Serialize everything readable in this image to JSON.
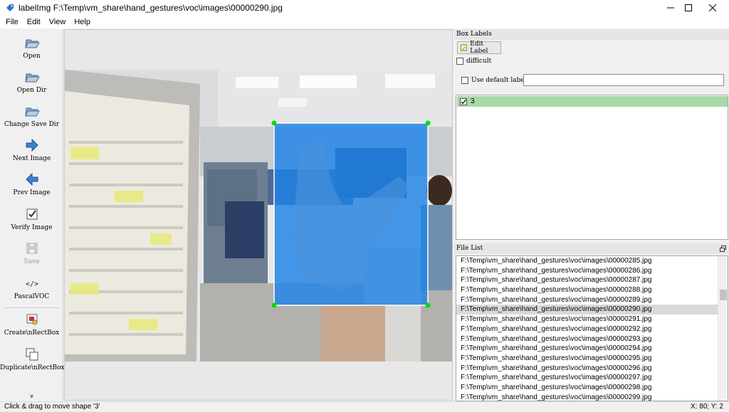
{
  "window": {
    "title": "labelImg F:\\Temp\\vm_share\\hand_gestures\\voc\\images\\00000290.jpg",
    "icon": "labelimg-tag-icon",
    "controls": [
      "minimize-icon",
      "maximize-icon",
      "close-icon"
    ]
  },
  "menu": [
    "File",
    "Edit",
    "View",
    "Help"
  ],
  "toolbar": {
    "open": "Open",
    "open_dir": "Open Dir",
    "change_save_dir": "Change Save Dir",
    "next_image": "Next Image",
    "prev_image": "Prev Image",
    "verify_image": "Verify Image",
    "save": "Save",
    "format": "PascalVOC",
    "create_rect": "Create\\nRectBox",
    "duplicate_rect": "Duplicate\\nRectBox",
    "more": "»"
  },
  "box_labels": {
    "title": "Box Labels",
    "edit_label": "Edit Label",
    "difficult": "difficult",
    "use_default_label": "Use default label",
    "default_label_value": "",
    "labels": [
      {
        "text": "3",
        "checked": true,
        "color": "#a8d8a8"
      }
    ]
  },
  "file_list": {
    "title": "File List",
    "selected_index": 5,
    "files": [
      "F:\\Temp\\vm_share\\hand_gestures\\voc\\images\\00000285.jpg",
      "F:\\Temp\\vm_share\\hand_gestures\\voc\\images\\00000286.jpg",
      "F:\\Temp\\vm_share\\hand_gestures\\voc\\images\\00000287.jpg",
      "F:\\Temp\\vm_share\\hand_gestures\\voc\\images\\00000288.jpg",
      "F:\\Temp\\vm_share\\hand_gestures\\voc\\images\\00000289.jpg",
      "F:\\Temp\\vm_share\\hand_gestures\\voc\\images\\00000290.jpg",
      "F:\\Temp\\vm_share\\hand_gestures\\voc\\images\\00000291.jpg",
      "F:\\Temp\\vm_share\\hand_gestures\\voc\\images\\00000292.jpg",
      "F:\\Temp\\vm_share\\hand_gestures\\voc\\images\\00000293.jpg",
      "F:\\Temp\\vm_share\\hand_gestures\\voc\\images\\00000294.jpg",
      "F:\\Temp\\vm_share\\hand_gestures\\voc\\images\\00000295.jpg",
      "F:\\Temp\\vm_share\\hand_gestures\\voc\\images\\00000296.jpg",
      "F:\\Temp\\vm_share\\hand_gestures\\voc\\images\\00000297.jpg",
      "F:\\Temp\\vm_share\\hand_gestures\\voc\\images\\00000298.jpg",
      "F:\\Temp\\vm_share\\hand_gestures\\voc\\images\\00000299.jpg"
    ]
  },
  "canvas": {
    "shape_label": "3",
    "shape_fill": "#1e82e6",
    "vertex_color": "#00dd00"
  },
  "status": {
    "message": "Click & drag to move shape '3'",
    "coords": "X: 80; Y: 2"
  }
}
